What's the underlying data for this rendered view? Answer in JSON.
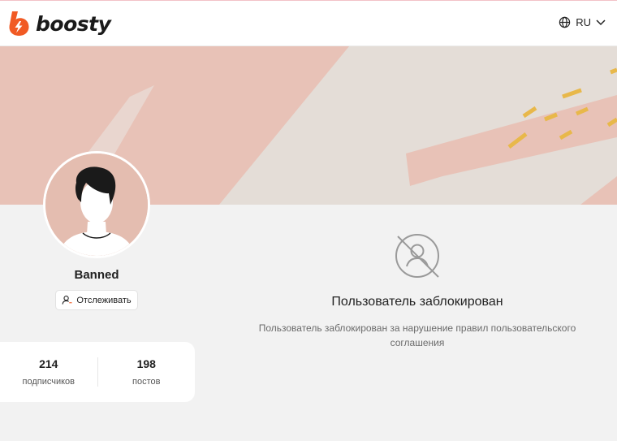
{
  "header": {
    "logo_text": "boosty",
    "language": "RU"
  },
  "profile": {
    "username": "Banned",
    "follow_label": "Отслеживать"
  },
  "stats": [
    {
      "value": "214",
      "label": "подписчиков"
    },
    {
      "value": "198",
      "label": "постов"
    }
  ],
  "blocked": {
    "title": "Пользователь заблокирован",
    "description": "Пользователь заблокирован за нарушение правил пользовательского соглашения"
  },
  "colors": {
    "brand_orange": "#f15a24",
    "banner_base": "#e4ddd7",
    "banner_stripe": "#e8c2b7",
    "accent_yellow": "#e8b84a"
  }
}
